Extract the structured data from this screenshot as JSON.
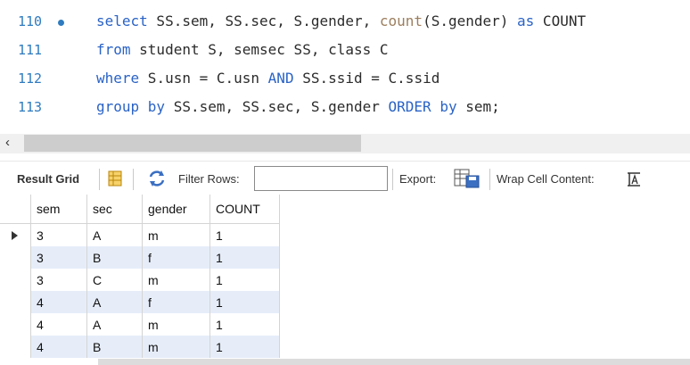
{
  "editor": {
    "lines": [
      {
        "number": "110",
        "has_marker": true,
        "tokens": [
          {
            "t": "select",
            "c": "kw"
          },
          {
            "t": " SS.sem, SS.sec, S.gender, ",
            "c": ""
          },
          {
            "t": "count",
            "c": "fn"
          },
          {
            "t": "(S.gender) ",
            "c": ""
          },
          {
            "t": "as",
            "c": "kw"
          },
          {
            "t": " COUNT",
            "c": ""
          }
        ]
      },
      {
        "number": "111",
        "has_marker": false,
        "tokens": [
          {
            "t": "from",
            "c": "kw"
          },
          {
            "t": " student S, semsec SS, class C",
            "c": ""
          }
        ]
      },
      {
        "number": "112",
        "has_marker": false,
        "tokens": [
          {
            "t": "where",
            "c": "kw"
          },
          {
            "t": " S.usn = C.usn ",
            "c": ""
          },
          {
            "t": "AND",
            "c": "kw"
          },
          {
            "t": " SS.ssid = C.ssid",
            "c": ""
          }
        ]
      },
      {
        "number": "113",
        "has_marker": false,
        "tokens": [
          {
            "t": "group by",
            "c": "kw"
          },
          {
            "t": " SS.sem, SS.sec, S.gender ",
            "c": ""
          },
          {
            "t": "ORDER by",
            "c": "kw"
          },
          {
            "t": " sem;",
            "c": ""
          }
        ]
      }
    ]
  },
  "toolbar": {
    "result_grid_label": "Result Grid",
    "filter_rows_label": "Filter Rows:",
    "filter_value": "",
    "export_label": "Export:",
    "wrap_label": "Wrap Cell Content:"
  },
  "grid": {
    "columns": [
      "sem",
      "sec",
      "gender",
      "COUNT"
    ],
    "rows": [
      [
        "3",
        "A",
        "m",
        "1"
      ],
      [
        "3",
        "B",
        "f",
        "1"
      ],
      [
        "3",
        "C",
        "m",
        "1"
      ],
      [
        "4",
        "A",
        "f",
        "1"
      ],
      [
        "4",
        "A",
        "m",
        "1"
      ],
      [
        "4",
        "B",
        "m",
        "1"
      ]
    ],
    "selected_row": 0
  },
  "colors": {
    "keyword": "#2a63c6",
    "function": "#9c7e5e",
    "line_number": "#2f7bbf",
    "alt_row": "#e6edf9"
  }
}
